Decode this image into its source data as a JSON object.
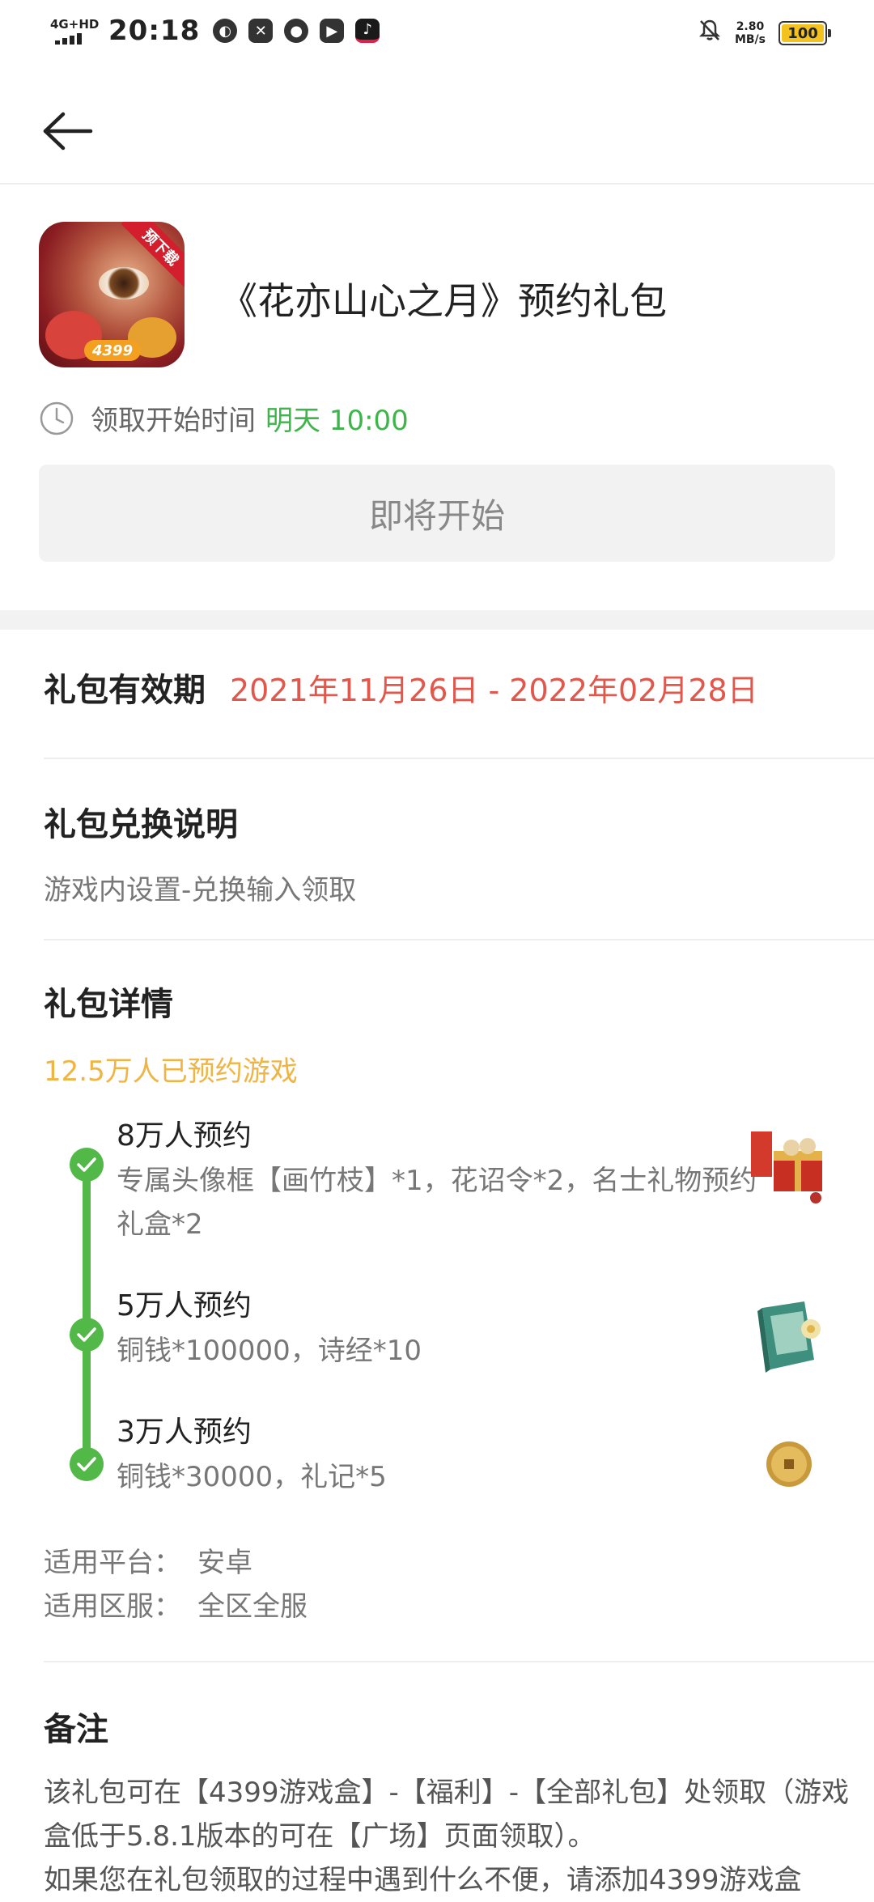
{
  "status_bar": {
    "network": "4G+HD",
    "time": "20:18",
    "speed_value": "2.80",
    "speed_unit": "MB/s",
    "battery": "100",
    "battery_level": 1.0
  },
  "header": {
    "icon_ribbon": "预下载",
    "icon_badge": "4399",
    "title": "《花亦山心之月》预约礼包",
    "time_label": "领取开始时间",
    "time_value": "明天 10:00",
    "start_button": "即将开始"
  },
  "validity": {
    "title": "礼包有效期",
    "dates": "2021年11月26日 - 2022年02月28日"
  },
  "exchange": {
    "title": "礼包兑换说明",
    "text": "游戏内设置-兑换输入领取"
  },
  "details": {
    "title": "礼包详情",
    "reserved": "12.5万人已预约游戏",
    "tiers": [
      {
        "head": "8万人预约",
        "desc": "专属头像框【画竹枝】*1，花诏令*2，名士礼物预约礼盒*2",
        "icon": "gift-box-icon"
      },
      {
        "head": "5万人预约",
        "desc": "铜钱*100000，诗经*10",
        "icon": "book-icon"
      },
      {
        "head": "3万人预约",
        "desc": "铜钱*30000，礼记*5",
        "icon": "coin-icon"
      }
    ],
    "platform_label": "适用平台：",
    "platform_value": "安卓",
    "server_label": "适用区服：",
    "server_value": "全区全服"
  },
  "notes": {
    "title": "备注",
    "line1": "该礼包可在【4399游戏盒】-【福利】-【全部礼包】处领取（游戏盒低于5.8.1版本的可在【广场】页面领取）。",
    "line2": "如果您在礼包领取的过程中遇到什么不便，请添加4399游戏盒"
  },
  "colors": {
    "accent_green": "#52b948",
    "date_red": "#e2574c",
    "reserved_orange": "#f0b443"
  }
}
